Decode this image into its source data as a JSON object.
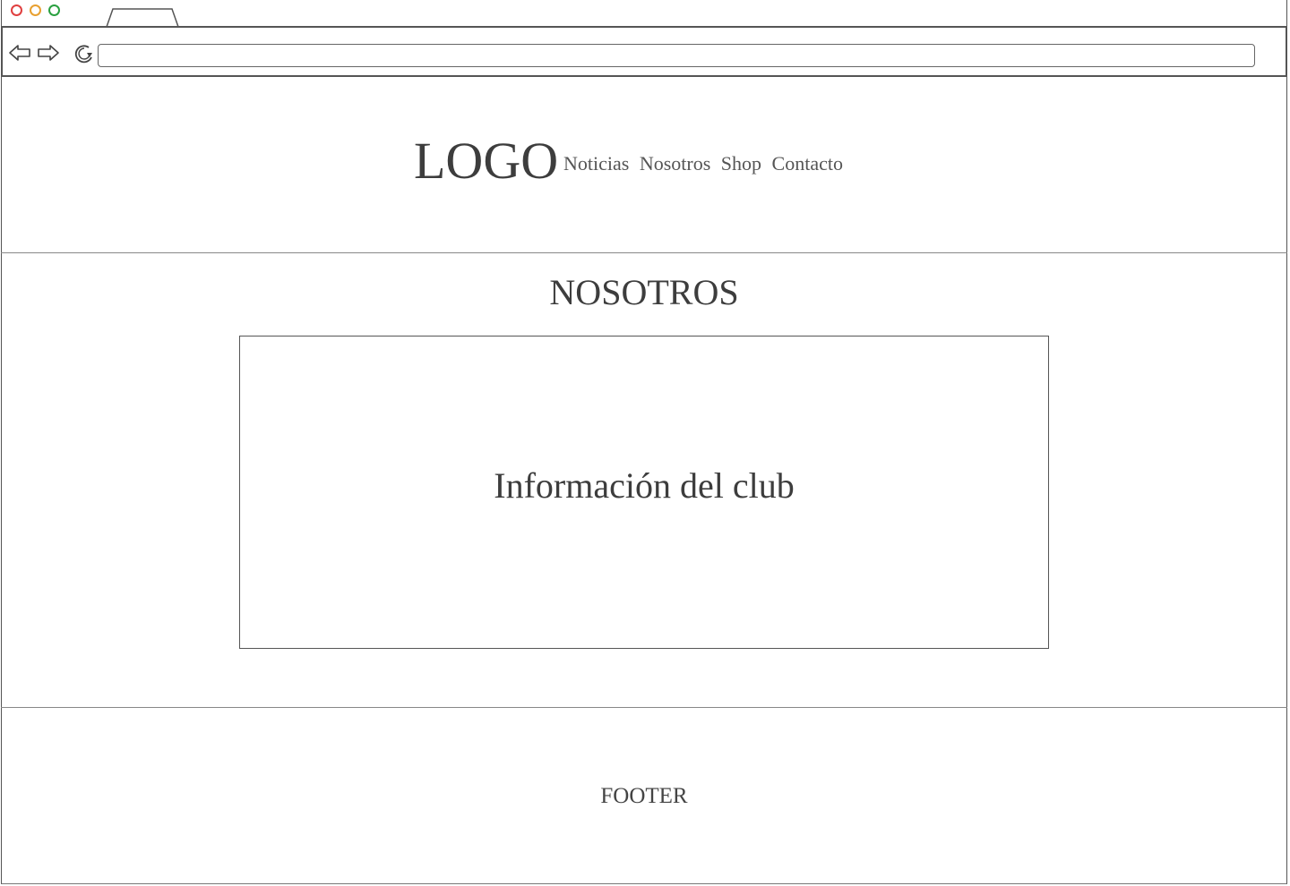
{
  "browser": {
    "controls": [
      "close",
      "minimize",
      "maximize"
    ],
    "back_icon": "arrow-left-icon",
    "forward_icon": "arrow-right-icon",
    "reload_icon": "reload-icon",
    "address_value": ""
  },
  "header": {
    "logo": "LOGO",
    "nav": [
      "Noticias",
      "Nosotros",
      "Shop",
      "Contacto"
    ]
  },
  "main": {
    "title": "NOSOTROS",
    "box_text": "Información del club"
  },
  "footer": {
    "text": "FOOTER"
  },
  "colors": {
    "close": "#e04040",
    "minimize": "#e8a030",
    "maximize": "#2aa040",
    "ink": "#444444"
  }
}
